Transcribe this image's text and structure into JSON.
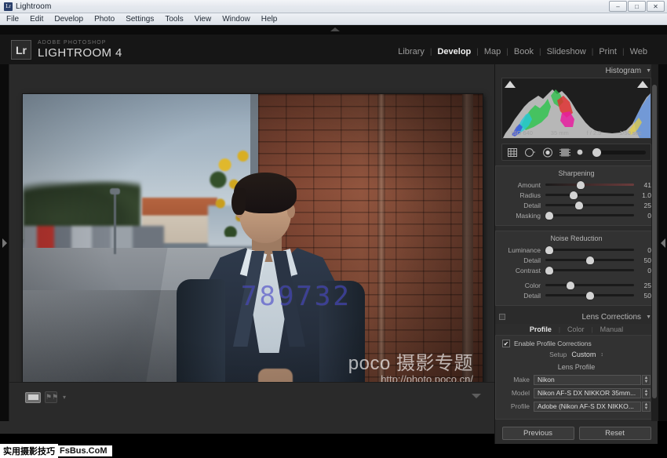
{
  "window": {
    "title": "Lightroom",
    "app_icon": "lr-app-icon",
    "buttons": {
      "minimize": "–",
      "maximize": "□",
      "close": "✕"
    }
  },
  "menubar": {
    "items": [
      "File",
      "Edit",
      "Develop",
      "Photo",
      "Settings",
      "Tools",
      "View",
      "Window",
      "Help"
    ]
  },
  "identity": {
    "badge": "Lr",
    "line1": "ADOBE PHOTOSHOP",
    "line2": "LIGHTROOM 4"
  },
  "modules": {
    "items": [
      "Library",
      "Develop",
      "Map",
      "Book",
      "Slideshow",
      "Print",
      "Web"
    ],
    "active": "Develop",
    "separator": "|"
  },
  "photo": {
    "watermark_number": "789732",
    "poco_brand": "poco 摄影专题",
    "poco_url": "http://photo.poco.cn/"
  },
  "toolbar": {
    "view_icon": "loupe-view-icon",
    "flag_icon": "flag-pick-icon",
    "caret": "▾"
  },
  "histogram": {
    "title": "Histogram",
    "chevron": "▼",
    "iso": "ISO 640",
    "focal": "35 mm",
    "aperture": "f / 2.5",
    "shutter": "1/50 sec"
  },
  "tools_strip": {
    "crop": "crop-overlay-icon",
    "spot": "spot-removal-icon",
    "redeye": "red-eye-icon",
    "graduated": "graduated-filter-icon",
    "brush": "adjustment-brush-icon"
  },
  "detail": {
    "sharpening": {
      "title": "Sharpening",
      "rows": [
        {
          "label": "Amount",
          "value": "41",
          "pos": 40
        },
        {
          "label": "Radius",
          "value": "1.0",
          "pos": 32
        },
        {
          "label": "Detail",
          "value": "25",
          "pos": 38
        },
        {
          "label": "Masking",
          "value": "0",
          "pos": 4
        }
      ]
    },
    "noise_reduction": {
      "title": "Noise Reduction",
      "rows_top": [
        {
          "label": "Luminance",
          "value": "0",
          "pos": 4
        },
        {
          "label": "Detail",
          "value": "50",
          "pos": 50
        },
        {
          "label": "Contrast",
          "value": "0",
          "pos": 4
        }
      ],
      "rows_bottom": [
        {
          "label": "Color",
          "value": "25",
          "pos": 28
        },
        {
          "label": "Detail",
          "value": "50",
          "pos": 50
        }
      ]
    }
  },
  "lens_corrections": {
    "title": "Lens Corrections",
    "chevron": "▼",
    "tabs": [
      "Profile",
      "Color",
      "Manual"
    ],
    "active_tab": "Profile",
    "enable_label": "Enable Profile Corrections",
    "enable_checked": "✔",
    "setup_label": "Setup",
    "setup_value": "Custom",
    "setup_arrows": "↕",
    "lens_profile_title": "Lens Profile",
    "fields": [
      {
        "label": "Make",
        "value": "Nikon"
      },
      {
        "label": "Model",
        "value": "Nikon AF-S DX NIKKOR 35mm..."
      },
      {
        "label": "Profile",
        "value": "Adobe (Nikon AF-S DX NIKKO..."
      }
    ]
  },
  "footer": {
    "previous": "Previous",
    "reset": "Reset"
  },
  "status": {
    "cn": "实用摄影技巧",
    "en": "FsBus.CoM"
  },
  "colors": {
    "panel_bg": "#2b2b2b",
    "section_bg": "#323232",
    "text": "#c2c2c2",
    "accent": "#d3d3d3",
    "watermark_blue": "#4a49c8"
  }
}
